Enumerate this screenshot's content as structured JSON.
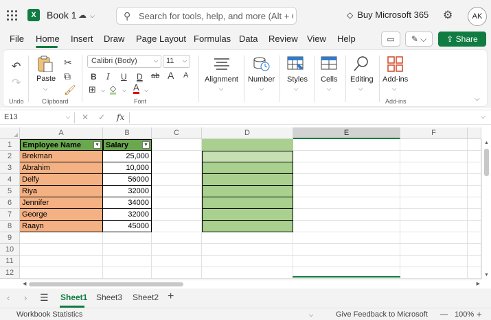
{
  "titlebar": {
    "app_logo": "X",
    "book_title": "Book 1",
    "search_placeholder": "Search for tools, help, and more (Alt + Q)",
    "buy_label": "Buy Microsoft 365",
    "avatar_initials": "AK"
  },
  "menu": {
    "tabs": [
      "File",
      "Home",
      "Insert",
      "Draw",
      "Page Layout",
      "Formulas",
      "Data",
      "Review",
      "View",
      "Help"
    ],
    "active_tab": "Home",
    "share_label": "Share"
  },
  "ribbon": {
    "undo_group": "Undo",
    "clipboard_group": "Clipboard",
    "paste_label": "Paste",
    "font_name": "Calibri (Body)",
    "font_size": "11",
    "font_group": "Font",
    "bold": "B",
    "italic": "I",
    "underline": "U",
    "double_underline": "D",
    "strike": "ab",
    "grow_font": "A",
    "shrink_font": "A",
    "alignment_label": "Alignment",
    "number_label": "Number",
    "styles_label": "Styles",
    "cells_label": "Cells",
    "editing_label": "Editing",
    "addins_label": "Add-ins",
    "addins_group": "Add-ins"
  },
  "formula_bar": {
    "name_box": "E13",
    "fx": "fx",
    "formula": ""
  },
  "sheet": {
    "columns": [
      "A",
      "B",
      "C",
      "D",
      "E",
      "F"
    ],
    "selected_column": "E",
    "rows": [
      "1",
      "2",
      "3",
      "4",
      "5",
      "6",
      "7",
      "8",
      "9",
      "10",
      "11",
      "12"
    ],
    "header": [
      "Employee Name",
      "Salary"
    ],
    "data": [
      {
        "name": "Brekman",
        "salary": "25,000"
      },
      {
        "name": "Abrahim",
        "salary": "10,000"
      },
      {
        "name": "Delfy",
        "salary": "56000"
      },
      {
        "name": "Riya",
        "salary": "32000"
      },
      {
        "name": "Jennifer",
        "salary": "34000"
      },
      {
        "name": "George",
        "salary": "32000"
      },
      {
        "name": "Raayn",
        "salary": "45000"
      }
    ],
    "colors": {
      "header_fill": "#6aa84f",
      "name_fill": "#f4b183",
      "d_fill": "#a9d08e",
      "accent": "#107c41"
    }
  },
  "sheet_tabs": {
    "tabs": [
      "Sheet1",
      "Sheet3",
      "Sheet2"
    ],
    "active": "Sheet1"
  },
  "status": {
    "left": "Workbook Statistics",
    "feedback": "Give Feedback to Microsoft",
    "zoom": "100%",
    "zoom_minus": "—",
    "zoom_plus": "+"
  }
}
